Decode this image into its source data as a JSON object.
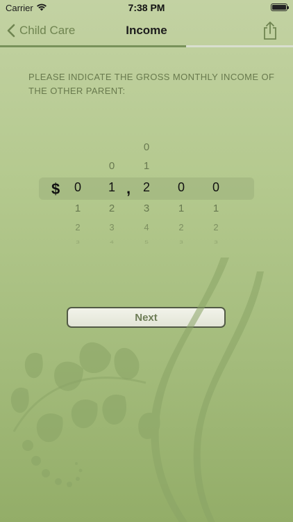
{
  "status_bar": {
    "carrier": "Carrier",
    "time": "7:38 PM"
  },
  "nav": {
    "back_label": "Child Care",
    "title": "Income"
  },
  "progress": {
    "fraction": 0.635
  },
  "prompt": "PLEASE INDICATE THE GROSS MONTHLY INCOME OF THE OTHER PARENT:",
  "picker": {
    "currency_symbol": "$",
    "separator": ",",
    "columns": [
      {
        "above": [
          "",
          ""
        ],
        "selected": "0",
        "below": [
          "1",
          "2",
          "3"
        ]
      },
      {
        "above": [
          "",
          "0"
        ],
        "selected": "1",
        "below": [
          "2",
          "3",
          "4"
        ]
      },
      {
        "above": [
          "0",
          "1"
        ],
        "selected": "2",
        "below": [
          "3",
          "4",
          "5"
        ]
      },
      {
        "above": [
          "",
          ""
        ],
        "selected": "0",
        "below": [
          "1",
          "2",
          "3"
        ]
      },
      {
        "above": [
          "",
          ""
        ],
        "selected": "0",
        "below": [
          "1",
          "2",
          "3"
        ]
      }
    ]
  },
  "next_button": {
    "label": "Next"
  },
  "colors": {
    "accent": "#6f8450",
    "background": "#b4c98e",
    "button_border": "#525a45"
  },
  "icons": {
    "back": "chevron-left-icon",
    "share": "share-icon",
    "wifi": "wifi-icon",
    "battery": "battery-icon"
  }
}
